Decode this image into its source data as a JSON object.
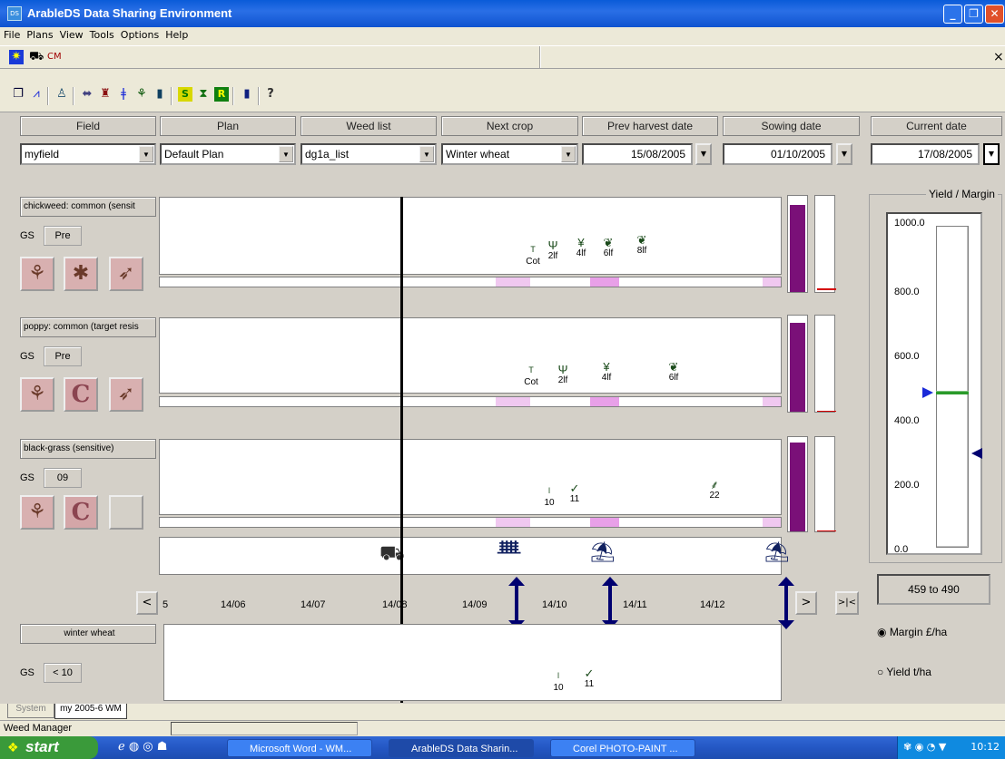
{
  "window": {
    "title": "ArableDS Data Sharing Environment",
    "icon_text": "DS"
  },
  "menu": [
    "File",
    "Plans",
    "View",
    "Tools",
    "Options",
    "Help"
  ],
  "toolbar1": {
    "label": "CM",
    "close": "×"
  },
  "headers": {
    "field": "Field",
    "plan": "Plan",
    "weed_list": "Weed list",
    "next_crop": "Next crop",
    "prev_harvest": "Prev harvest date",
    "sowing": "Sowing date",
    "current": "Current date"
  },
  "values": {
    "field": "myfield",
    "plan": "Default Plan",
    "weed_list": "dg1a_list",
    "next_crop": "Winter wheat",
    "prev_harvest": "15/08/2005",
    "sowing": "01/10/2005",
    "current": "17/08/2005"
  },
  "weeds": [
    {
      "name": "chickweed: common (sensit",
      "gs_label": "GS",
      "gs": "Pre",
      "stages": [
        "Cot",
        "2lf",
        "4lf",
        "6lf",
        "8lf"
      ]
    },
    {
      "name": "poppy: common (target resis",
      "gs_label": "GS",
      "gs": "Pre",
      "stages": [
        "Cot",
        "2lf",
        "4lf",
        "6lf"
      ]
    },
    {
      "name": "black-grass (sensitive)",
      "gs_label": "GS",
      "gs": "09",
      "stages": [
        "10",
        "11",
        "22"
      ]
    }
  ],
  "timeline": {
    "labels": [
      "5",
      "14/06",
      "14/07",
      "14/08",
      "14/09",
      "14/10",
      "14/11",
      "14/12"
    ],
    "prev": "<",
    "next": ">",
    "jump": ">|<"
  },
  "crop": {
    "name": "winter wheat",
    "gs_label": "GS",
    "gs": "< 10",
    "stages": [
      "10",
      "11"
    ]
  },
  "yield_margin": {
    "title": "Yield / Margin",
    "ticks": [
      "1000.0",
      "800.0",
      "600.0",
      "400.0",
      "200.0",
      "0.0"
    ],
    "range": "459 to 490",
    "margin_label": "Margin  £/ha",
    "yield_label": "Yield   t/ha",
    "selected": "margin"
  },
  "tabs": [
    "System",
    "my 2005-6 WM"
  ],
  "status": "Weed Manager",
  "taskbar": {
    "start": "start",
    "tasks": [
      "Microsoft Word - WM...",
      "ArableDS Data Sharin...",
      "Corel PHOTO-PAINT ..."
    ],
    "clock": "10:12"
  },
  "colors": {
    "title_blue": "#0a5bd8",
    "bar_purple": "#7a1078",
    "timing_pink": "#f0c8f0",
    "arrow_navy": "#000070"
  }
}
